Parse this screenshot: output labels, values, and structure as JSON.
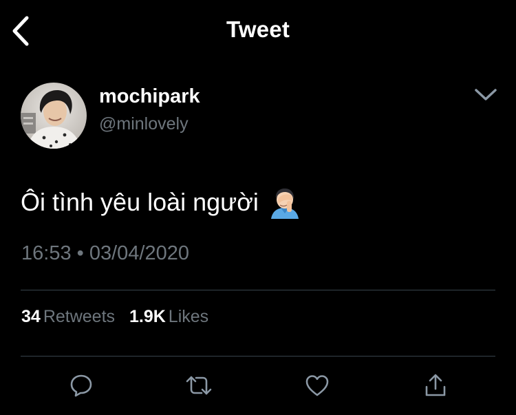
{
  "header": {
    "title": "Tweet",
    "back_icon": "chevron-left-icon"
  },
  "author": {
    "display_name": "mochipark",
    "handle": "@minlovely",
    "menu_icon": "chevron-down-icon"
  },
  "tweet": {
    "text": "Ôi tình yêu loài người",
    "emoji": "person-facepalming-emoji",
    "time": "16:53",
    "separator": "•",
    "date": "03/04/2020"
  },
  "stats": {
    "retweets_count": "34",
    "retweets_label": "Retweets",
    "likes_count": "1.9K",
    "likes_label": "Likes"
  },
  "actions": {
    "icons": [
      "reply-icon",
      "retweet-icon",
      "like-icon",
      "share-icon"
    ]
  },
  "colors": {
    "background": "#000000",
    "text_primary": "#ffffff",
    "text_secondary": "#6e767d",
    "divider": "#38444d"
  }
}
